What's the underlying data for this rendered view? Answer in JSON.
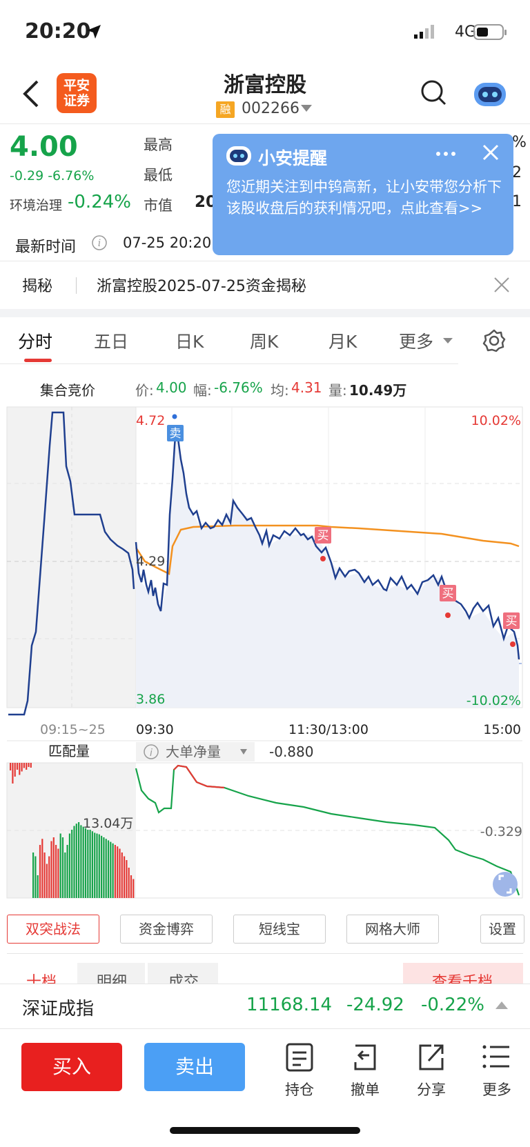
{
  "status": {
    "time": "20:20",
    "network": "4G"
  },
  "header": {
    "logo_line1": "平安",
    "logo_line2": "证券",
    "stock_name": "浙富控股",
    "badge": "融",
    "code": "002266"
  },
  "quote": {
    "price": "4.00",
    "change": "-0.29 -6.76%",
    "sector_name": "环境治理",
    "sector_change": "-0.24%",
    "label_high": "最高",
    "label_low": "最低",
    "label_mcap": "市值",
    "mcap_partial": "20",
    "updated_label": "最新时间",
    "updated_value": "07-25 20:20",
    "right_clip1": "%",
    "right_clip2": "2",
    "right_clip3": "1"
  },
  "popup": {
    "title": "小安提醒",
    "text": "您近期关注到中钨高新，让小安带您分析下该股收盘后的获利情况吧，点此查看>>"
  },
  "jiemi": {
    "label": "揭秘",
    "text": "浙富控股2025-07-25资金揭秘"
  },
  "tabs": [
    "分时",
    "五日",
    "日K",
    "周K",
    "月K",
    "更多"
  ],
  "info": {
    "auction_label": "集合竞价",
    "price_label": "价:",
    "price": "4.00",
    "amp_label": "幅:",
    "amp": "-6.76%",
    "avg_label": "均:",
    "avg": "4.31",
    "vol_label": "量:",
    "vol": "10.49万"
  },
  "chart": {
    "y_high": "4.72",
    "y_low": "3.86",
    "y_mid": "4.29",
    "pct_high": "10.02%",
    "pct_low": "-10.02%",
    "x_labels": [
      "09:15~25",
      "09:30",
      "11:30/13:00",
      "15:00"
    ],
    "sell_marker": "卖",
    "buy_marker": "买",
    "sub_left_label": "匹配量",
    "sub_indicator": "大单净量",
    "sub_value": "-0.880",
    "sub_vol_label": "13.04万",
    "sub_right_value": "-0.329"
  },
  "chart_data": {
    "type": "line",
    "series": [
      {
        "values": [
          4.29,
          4.18,
          4.12,
          4.24,
          4.62,
          4.48,
          4.4,
          4.38,
          4.4,
          4.36,
          4.37,
          4.33,
          4.35,
          4.3,
          4.29,
          4.24,
          4.22,
          4.19,
          4.13,
          4.12,
          4.06,
          4.0
        ]
      },
      {
        "values": [
          4.29,
          4.23,
          4.3,
          4.33,
          4.34,
          4.34,
          4.34,
          4.34,
          4.34,
          4.33,
          4.33,
          4.33,
          4.32,
          4.32,
          4.32,
          4.31
        ]
      }
    ],
    "ylim": [
      3.86,
      4.72
    ]
  },
  "toolbar": [
    "双突战法",
    "资金博弈",
    "短线宝",
    "网格大师",
    "设置"
  ],
  "subtabs": [
    "十档",
    "明细",
    "成交",
    "查看千档"
  ],
  "index": {
    "name": "深证成指",
    "value": "11168.14",
    "change": "-24.92",
    "pct": "-0.22%"
  },
  "bottom": {
    "buy": "买入",
    "sell": "卖出",
    "hold": "持仓",
    "cancel": "撤单",
    "share": "分享",
    "more": "更多"
  }
}
